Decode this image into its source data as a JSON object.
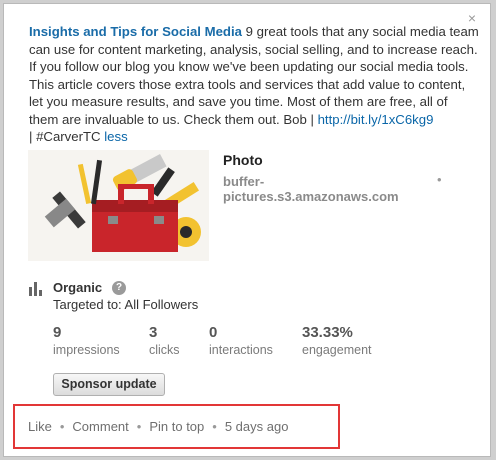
{
  "post": {
    "title": "Insights and Tips for Social Media",
    "body": " 9 great tools that any social media team can use for content marketing, analysis, social selling, and to increase reach. If you follow our blog you know we've been updating our social media tools. This article covers those extra tools and services that add value to content, let you measure results, and save you time. Most of them are free, all of them are invaluable to us. Check them out. Bob | ",
    "link": "http://bit.ly/1xC6kg9",
    "hashtag_prefix": " | #CarverTC ",
    "less": "less"
  },
  "attachment": {
    "type": "Photo",
    "source": "buffer-pictures.s3.amazonaws.com",
    "bullet": "•"
  },
  "targeting": {
    "label": "Organic",
    "help": "?",
    "targeted": "Targeted to: All Followers"
  },
  "stats": [
    {
      "value": "9",
      "label": "impressions"
    },
    {
      "value": "3",
      "label": "clicks"
    },
    {
      "value": "0",
      "label": "interactions"
    },
    {
      "value": "33.33%",
      "label": "engagement"
    }
  ],
  "sponsor_label": "Sponsor update",
  "actions": {
    "like": "Like",
    "comment": "Comment",
    "pin": "Pin to top",
    "time": "5 days ago",
    "sep": "•"
  },
  "close": "×",
  "colors": {
    "link": "#0a66a8",
    "highlight_border": "#e23636",
    "toolbox": "#c9252b"
  }
}
